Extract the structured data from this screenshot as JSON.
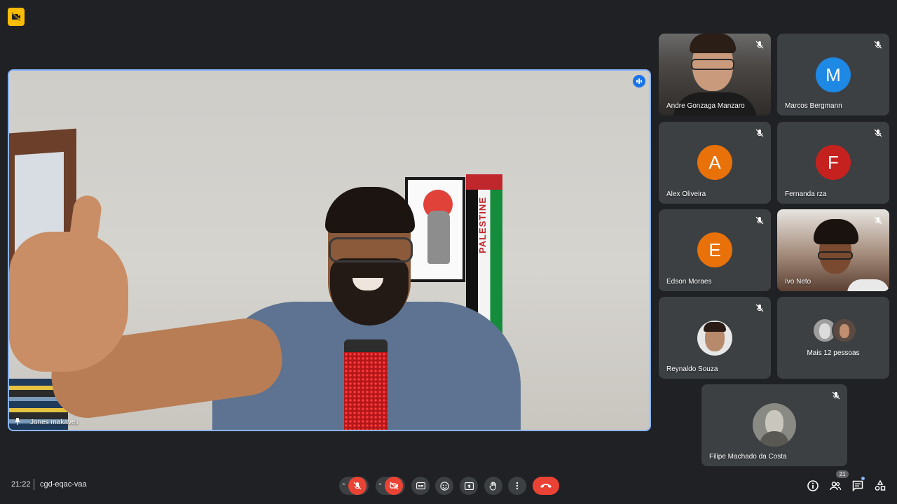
{
  "main_speaker": {
    "name": "Jones makaveli",
    "scarf_text": "PALESTINE"
  },
  "participants": [
    {
      "name": "Andre Gonzaga Manzaro",
      "type": "video",
      "muted": true
    },
    {
      "name": "Marcos Bergmann",
      "type": "initial",
      "initial": "M",
      "color": "#1e88e5",
      "muted": true
    },
    {
      "name": "Alex Oliveira",
      "type": "initial",
      "initial": "A",
      "color": "#e8710a",
      "muted": true
    },
    {
      "name": "Fernanda rza",
      "type": "initial",
      "initial": "F",
      "color": "#c5221f",
      "muted": true
    },
    {
      "name": "Edson Moraes",
      "type": "initial",
      "initial": "E",
      "color": "#e8710a",
      "muted": true
    },
    {
      "name": "Ivo Neto",
      "type": "video",
      "muted": true
    },
    {
      "name": "Reynaldo Souza",
      "type": "photo",
      "muted": true
    },
    {
      "name": "Mais 12 pessoas",
      "type": "more"
    },
    {
      "name": "Filipe Machado da Costa",
      "type": "photo",
      "muted": true
    }
  ],
  "bottom_bar": {
    "time": "21:22",
    "meeting_code": "cgd-eqac-vaa",
    "people_count": "21"
  },
  "colors": {
    "background": "#202124",
    "tile": "#3c4043",
    "active_border": "#8ab4f8",
    "danger": "#ea4335",
    "recording": "#fbbc04"
  },
  "icons": [
    "recording-icon",
    "speaking-icon",
    "pin-icon",
    "mic-off-icon",
    "video-off-icon",
    "captions-icon",
    "emoji-icon",
    "present-icon",
    "raise-hand-icon",
    "more-options-icon",
    "end-call-icon",
    "info-icon",
    "people-icon",
    "chat-icon",
    "activities-icon"
  ]
}
